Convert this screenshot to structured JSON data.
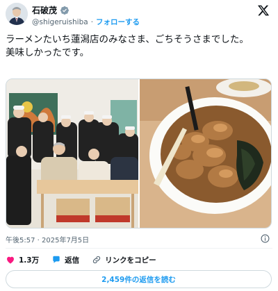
{
  "author": {
    "display_name": "石破茂",
    "handle": "@shigeruishiba",
    "separator": "·",
    "follow_label": "フォローする"
  },
  "tweet": {
    "text": "ラーメンたいち蓮潟店のみなさま、ごちそうさまでした。\n美味しかったです。"
  },
  "meta": {
    "time": "午後5:57 · 2025年7月5日"
  },
  "actions": {
    "likes": "1.3万",
    "reply_label": "返信",
    "copy_link_label": "リンクをコピー"
  },
  "replies_button_label": "2,459件の返信を読む",
  "colors": {
    "accent": "#1d9bf0",
    "like": "#f91880",
    "text": "#0f1419",
    "secondary": "#536471"
  },
  "icons": [
    "verified-badge-icon",
    "x-logo-icon",
    "info-icon",
    "heart-icon",
    "reply-bubble-icon",
    "link-icon"
  ]
}
